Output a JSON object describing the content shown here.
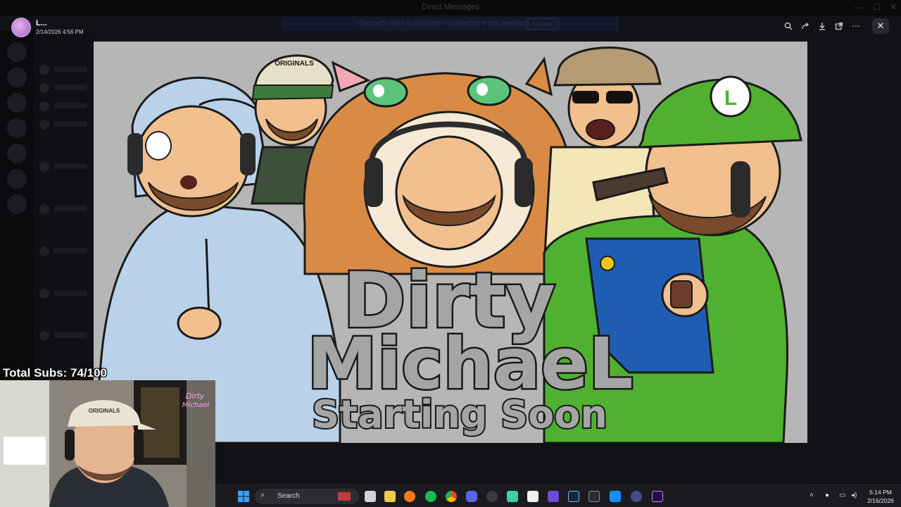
{
  "window": {
    "title": "Direct Messages",
    "banner_text": "Discord's Nitro is available in limited time this weekend",
    "banner_button": "Update"
  },
  "viewer": {
    "username": "L...",
    "timestamp": "2/14/2026 4:56 PM",
    "actions": [
      "zoom-in-icon",
      "forward-icon",
      "download-icon",
      "open-external-icon",
      "more-icon"
    ],
    "close_icon": "close-icon"
  },
  "artwork": {
    "title_line1": "Dirty",
    "title_line2": "MichaeL",
    "subtitle": "Starting Soon",
    "cap_text": "ORIGINALS",
    "cap_letter": "L"
  },
  "stream_overlay": {
    "subs_label": "Total Subs: 74/100",
    "cap_text": "ORIGINALS",
    "neon_sign_line1": "Dirty",
    "neon_sign_line2": "Michael"
  },
  "taskbar": {
    "search_placeholder": "Search",
    "time": "5:14 PM",
    "date": "2/16/2026",
    "apps": [
      "file-explorer-icon",
      "files-icon",
      "firefox-icon",
      "spotify-icon",
      "chrome-icon",
      "discord-icon",
      "obs-icon",
      "app-green-icon",
      "capcut-icon",
      "app-grid-icon",
      "steam-icon",
      "epic-icon",
      "battlenet-icon",
      "app-circle-icon",
      "premiere-icon"
    ],
    "tray_icons": [
      "chevron-up-icon",
      "microphone-icon",
      "display-icon",
      "volume-icon"
    ]
  },
  "colors": {
    "accent_purple": "#a15fc0",
    "taskbar_bg": "#1b1b1f",
    "art_bg": "#b6b6b6",
    "luigi_green": "#4fb12f",
    "overalls_blue": "#1f5db3",
    "cat_orange": "#d98b45"
  }
}
